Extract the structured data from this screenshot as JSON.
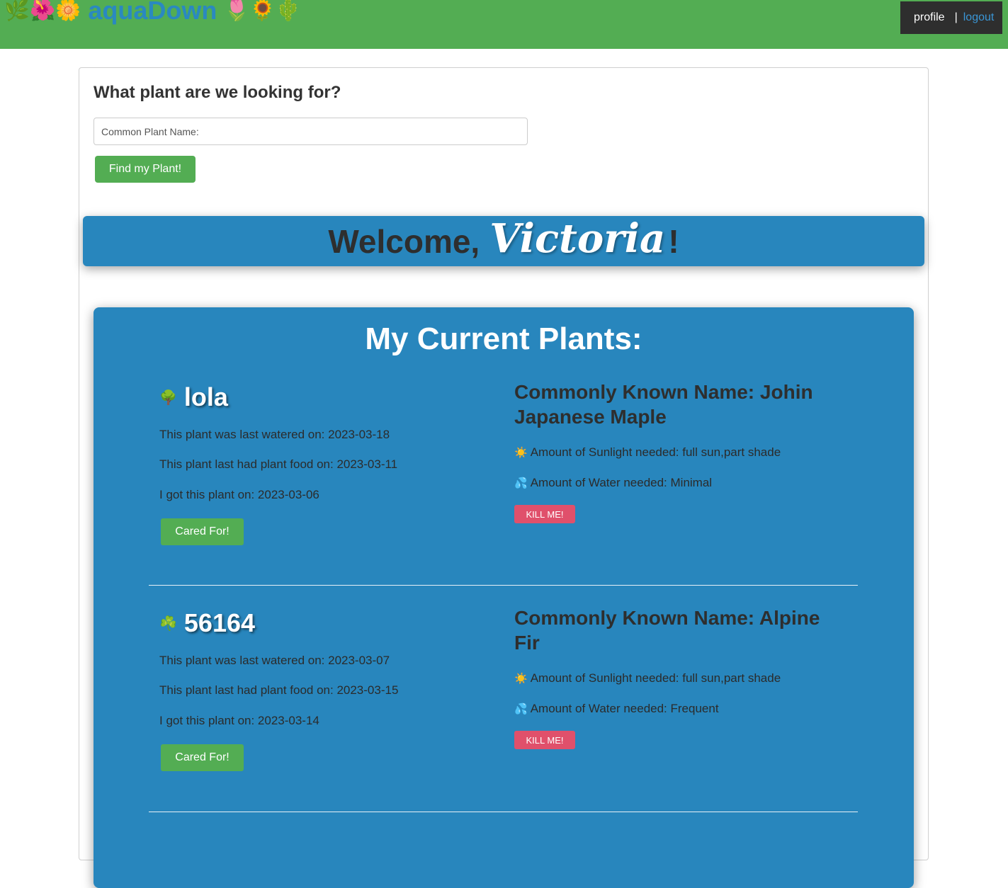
{
  "header": {
    "emoji_left": "🌿🌺🌼",
    "app_title": "aquaDown",
    "emoji_right": "🌷🌻🌵",
    "profile_label": "profile",
    "separator": "|",
    "logout_label": "logout"
  },
  "search": {
    "heading": "What plant are we looking for?",
    "placeholder": "Common Plant Name:",
    "value": "",
    "button_label": "Find my Plant!"
  },
  "welcome": {
    "prefix": "Welcome,",
    "user_name": "Victoria",
    "suffix": "!"
  },
  "plants_section": {
    "title": "My Current Plants:"
  },
  "plants": [
    {
      "icon": "🌳",
      "name": "lola",
      "last_watered": "This plant was last watered on: 2023-03-18",
      "last_food": "This plant last had plant food on: 2023-03-11",
      "acquired": "I got this plant on: 2023-03-06",
      "cared_label": "Cared For!",
      "common_name": "Commonly Known Name: Johin Japanese Maple",
      "sun_icon": "☀️",
      "sunlight": "Amount of Sunlight needed: full sun,part shade",
      "water_icon": "💦",
      "water": "Amount of Water needed: Minimal",
      "kill_label": "KILL ME!"
    },
    {
      "icon": "☘️",
      "name": "56164",
      "last_watered": "This plant was last watered on: 2023-03-07",
      "last_food": "This plant last had plant food on: 2023-03-15",
      "acquired": "I got this plant on: 2023-03-14",
      "cared_label": "Cared For!",
      "common_name": "Commonly Known Name: Alpine Fir",
      "sun_icon": "☀️",
      "sunlight": "Amount of Sunlight needed: full sun,part shade",
      "water_icon": "💦",
      "water": "Amount of Water needed: Frequent",
      "kill_label": "KILL ME!"
    }
  ],
  "colors": {
    "header_green": "#53ad53",
    "brand_blue": "#2a89c0",
    "panel_blue": "#2886bd",
    "button_green": "#53ad53",
    "kill_red": "#e0506b",
    "account_bg": "#2e2e2e"
  }
}
